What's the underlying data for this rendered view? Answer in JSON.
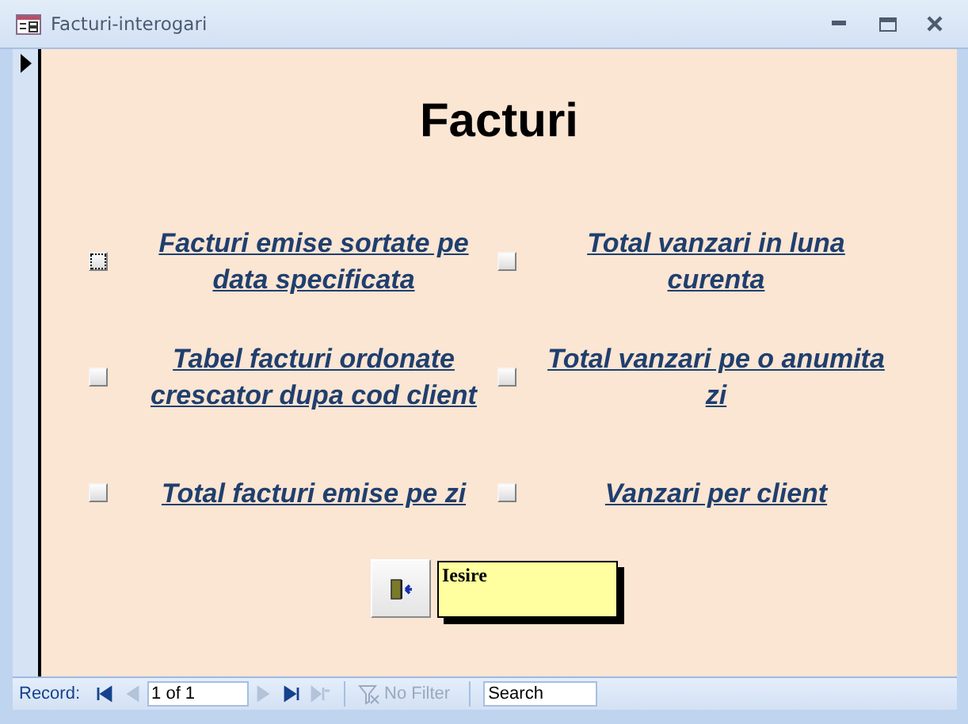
{
  "window": {
    "title": "Facturi-interogari"
  },
  "form": {
    "title": "Facturi",
    "options": [
      {
        "label": "Facturi emise sortate pe data specificata",
        "checked": false,
        "focused": true
      },
      {
        "label": "Total vanzari in luna curenta",
        "checked": false,
        "focused": false
      },
      {
        "label": "Tabel facturi ordonate crescator dupa cod client",
        "checked": false,
        "focused": false
      },
      {
        "label": "Total vanzari pe o anumita zi",
        "checked": false,
        "focused": false
      },
      {
        "label": "Total facturi emise pe zi",
        "checked": false,
        "focused": false
      },
      {
        "label": "Vanzari per client",
        "checked": false,
        "focused": false
      }
    ],
    "exit_label": "Iesire"
  },
  "status_bar": {
    "record_label": "Record:",
    "record_position": "1 of 1",
    "filter": {
      "label": "No Filter",
      "disabled": true
    },
    "search": {
      "placeholder": "Search"
    },
    "nav_buttons": [
      {
        "kind": "first",
        "disabled": false
      },
      {
        "kind": "prev",
        "disabled": true
      },
      {
        "kind": "next",
        "disabled": true
      },
      {
        "kind": "last",
        "disabled": false
      },
      {
        "kind": "new",
        "disabled": true
      }
    ]
  }
}
